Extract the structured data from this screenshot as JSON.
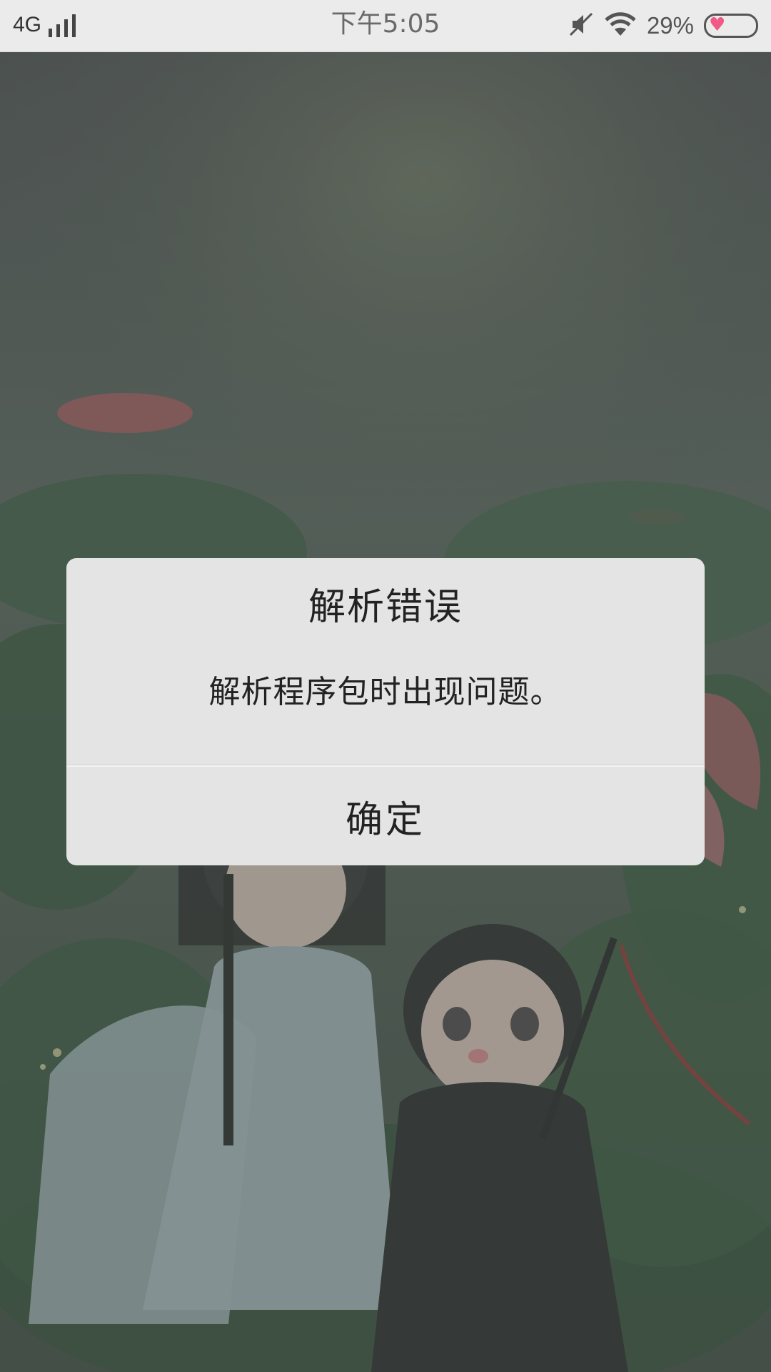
{
  "status_bar": {
    "network": "4G",
    "time": "下午5:05",
    "battery_percent": "29%",
    "icons": [
      "signal-icon",
      "mute-icon",
      "wifi-icon",
      "battery-icon"
    ]
  },
  "dialog": {
    "title": "解析错误",
    "message": "解析程序包时出现问题。",
    "confirm_label": "确定"
  },
  "colors": {
    "dialog_bg": "#e4e4e4",
    "status_bar_bg": "#ebebeb",
    "battery_heart": "#f05a86"
  }
}
